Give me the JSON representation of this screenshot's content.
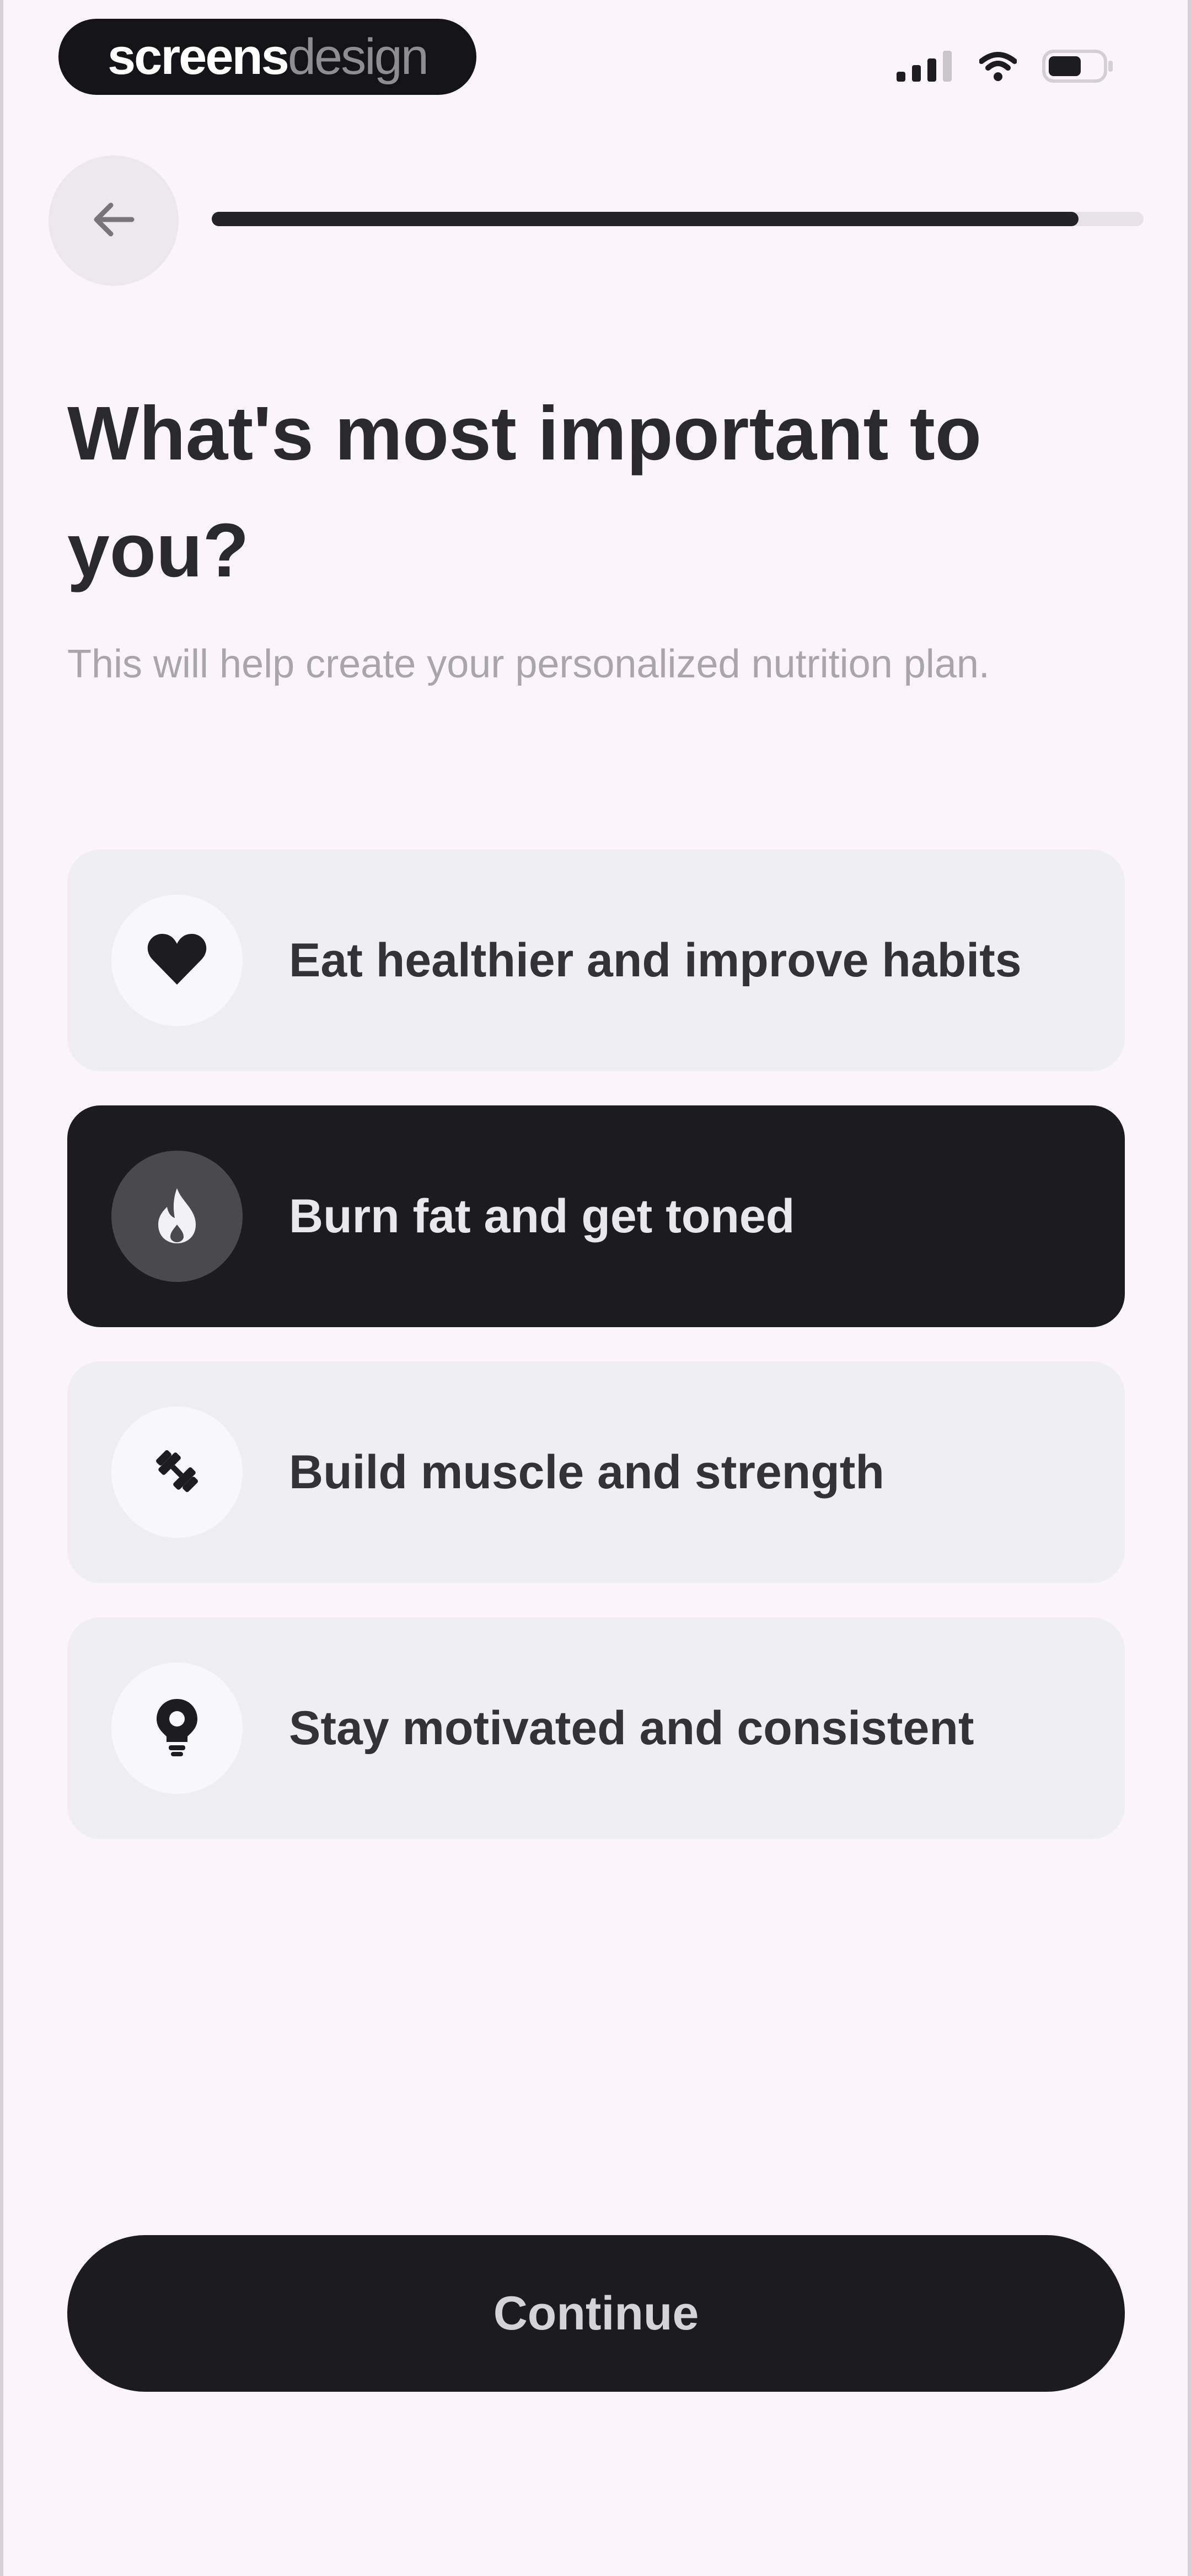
{
  "status_bar": {
    "brand_part1": "screens",
    "brand_part2": "design"
  },
  "progress": {
    "value": 0.93
  },
  "header": {
    "title": "What's most important to you?",
    "subtitle": "This will help create your personalized nutrition plan."
  },
  "options": [
    {
      "label": "Eat healthier and improve habits",
      "icon": "heart-icon",
      "selected": false
    },
    {
      "label": "Burn fat and get toned",
      "icon": "flame-icon",
      "selected": true
    },
    {
      "label": "Build muscle and strength",
      "icon": "dumbbell-icon",
      "selected": false
    },
    {
      "label": "Stay motivated and consistent",
      "icon": "lightbulb-icon",
      "selected": false
    }
  ],
  "footer": {
    "continue_label": "Continue"
  },
  "colors": {
    "background": "#fcf4fb",
    "selected": "#1c1c1e",
    "unselected": "#efeff3"
  }
}
